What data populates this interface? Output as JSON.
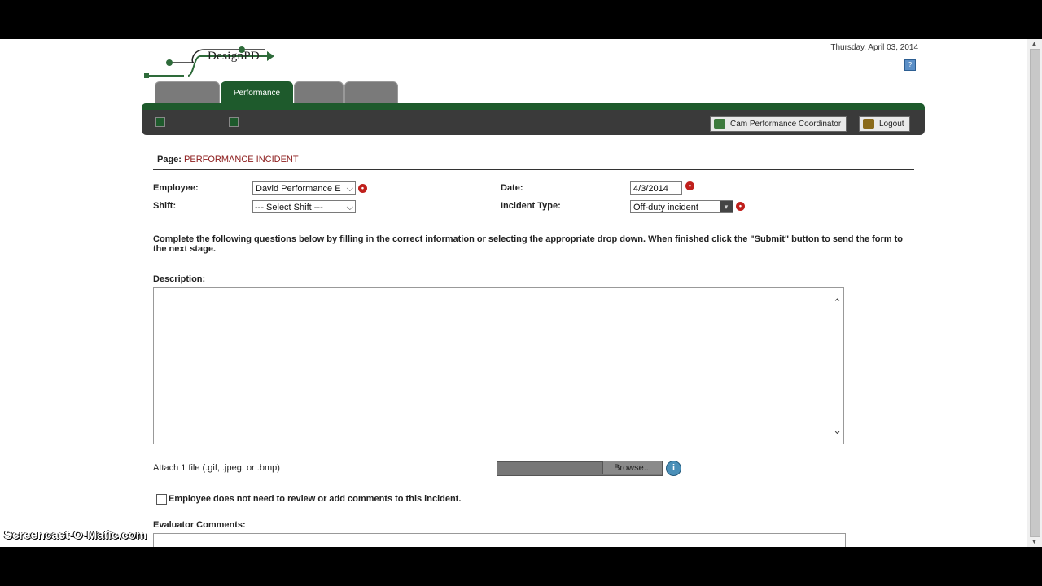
{
  "header": {
    "brand_text": "DesignPD",
    "date": "Thursday, April 03, 2014",
    "help_icon": "help-icon"
  },
  "tabs": [
    {
      "label": "",
      "active": false
    },
    {
      "label": "Performance",
      "active": true
    },
    {
      "label": "",
      "active": false
    },
    {
      "label": "",
      "active": false
    }
  ],
  "toolbar": {
    "coordinator_label": "Cam Performance Coordinator",
    "logout_label": "Logout"
  },
  "page": {
    "prefix": "Page:",
    "title": "PERFORMANCE INCIDENT"
  },
  "form": {
    "employee_label": "Employee:",
    "employee_value": "David Performance E",
    "shift_label": "Shift:",
    "shift_value": "--- Select Shift ---",
    "date_label": "Date:",
    "date_value": "4/3/2014",
    "incident_type_label": "Incident Type:",
    "incident_type_value": "Off-duty incident",
    "instructions": "Complete the following questions below by filling in the correct information or selecting the appropriate drop down. When finished click the \"Submit\" button to send the form to the next stage.",
    "description_label": "Description:",
    "description_value": "",
    "attach_label": "Attach 1 file (.gif, .jpeg, or .bmp)",
    "browse_label": "Browse...",
    "no_review_label": "Employee does not need to review or add comments to this incident.",
    "no_review_checked": false,
    "evaluator_label": "Evaluator Comments:"
  },
  "watermark": "Screencast-O-Matic.com",
  "colors": {
    "brand_green": "#1e5a2c",
    "required_red": "#c0201c",
    "title_red": "#8b1a1a"
  }
}
